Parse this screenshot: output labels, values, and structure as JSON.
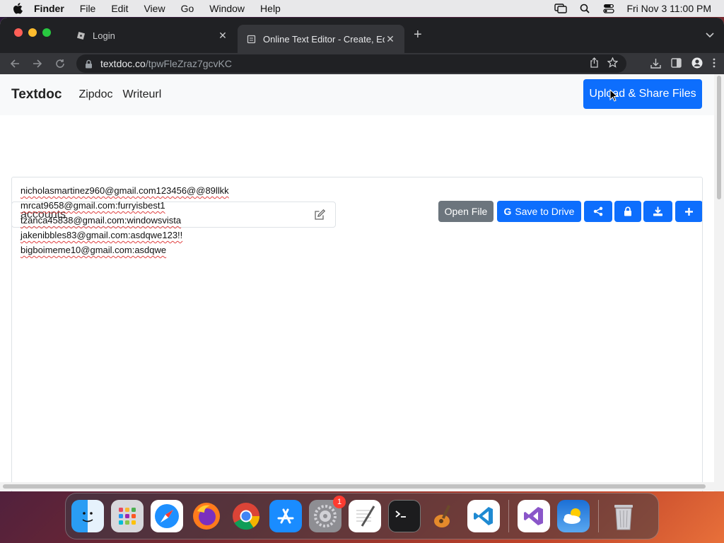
{
  "menubar": {
    "app": "Finder",
    "items": [
      "File",
      "Edit",
      "View",
      "Go",
      "Window",
      "Help"
    ],
    "clock": "Fri Nov 3  11:00 PM"
  },
  "browser": {
    "tabs": [
      {
        "label": "Login",
        "active": false
      },
      {
        "label": "Online Text Editor - Create, Ed",
        "active": true
      }
    ],
    "url_host": "textdoc.co",
    "url_path": "/tpwFleZraz7gcvKC"
  },
  "site": {
    "brand": "Textdoc",
    "nav_links": [
      "Zipdoc",
      "Writeurl"
    ],
    "upload_button": "Upload & Share Files"
  },
  "document": {
    "filename": "accounts",
    "open_file": "Open File",
    "save_drive": "Save to Drive",
    "lines": [
      "nicholasmartinez960@gmail.com123456@@89llkk",
      "mrcat9658@gmail.com:furryisbest1",
      "tzanca45838@gmail.com:windowsvista",
      "jakenibbles83@gmail.com:asdqwe123!!",
      "bigboimeme10@gmail.com:asdqwe"
    ]
  },
  "dock": {
    "settings_badge": "1"
  },
  "colors": {
    "primary": "#0d6efd",
    "secondary": "#6c757d"
  }
}
